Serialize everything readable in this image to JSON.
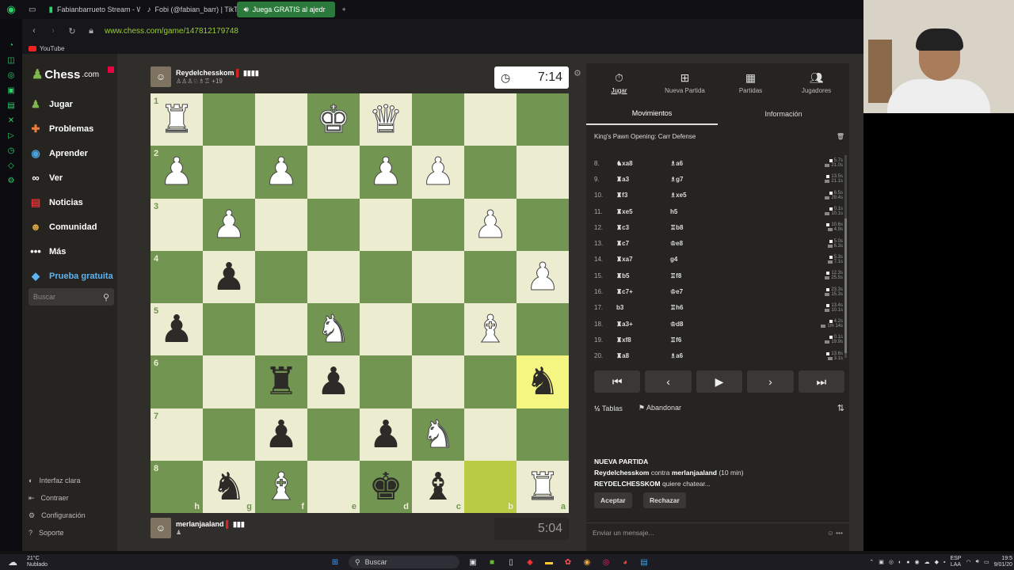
{
  "browser": {
    "tabs": [
      {
        "label": "Fabianbarrueto Stream - W",
        "icon": "twitch-icon",
        "active": false
      },
      {
        "label": "Fobi (@fabian_barr) | TikT",
        "icon": "tiktok-icon",
        "active": false
      },
      {
        "label": "Juega GRATIS al ajedr",
        "icon": "chess-icon",
        "active": true
      }
    ],
    "url": "www.chess.com/game/147812179748",
    "bookmark": "YouTube"
  },
  "sidebar": {
    "logo": "Chess",
    "logo_suffix": ".com",
    "items": [
      {
        "label": "Jugar",
        "icon": "pawn-icon"
      },
      {
        "label": "Problemas",
        "icon": "puzzle-icon"
      },
      {
        "label": "Aprender",
        "icon": "learn-icon"
      },
      {
        "label": "Ver",
        "icon": "binoculars-icon"
      },
      {
        "label": "Noticias",
        "icon": "news-icon"
      },
      {
        "label": "Comunidad",
        "icon": "community-icon"
      },
      {
        "label": "Más",
        "icon": "more-icon"
      },
      {
        "label": "Prueba gratuita",
        "icon": "diamond-icon"
      }
    ],
    "search_placeholder": "Buscar",
    "bottom": [
      {
        "label": "Interfaz clara",
        "icon": "theme-icon"
      },
      {
        "label": "Contraer",
        "icon": "collapse-icon"
      },
      {
        "label": "Configuración",
        "icon": "gear-icon"
      },
      {
        "label": "Soporte",
        "icon": "help-icon"
      }
    ]
  },
  "top_player": {
    "name": "Reydelchesskom",
    "material": "+19",
    "clock": "7:14"
  },
  "bottom_player": {
    "name": "merlanjaaland",
    "clock": "5:04"
  },
  "board": {
    "ranks": [
      "1",
      "2",
      "3",
      "4",
      "5",
      "6",
      "7",
      "8"
    ],
    "files": [
      "h",
      "g",
      "f",
      "e",
      "d",
      "c",
      "b",
      "a"
    ],
    "highlight": [
      [
        5,
        7
      ],
      [
        7,
        6
      ]
    ],
    "pieces": [
      [
        "wR",
        "",
        "",
        "wK",
        "wQ",
        "",
        "",
        ""
      ],
      [
        "wP",
        "",
        "wP",
        "",
        "wP",
        "wP",
        "",
        ""
      ],
      [
        "",
        "wP",
        "",
        "",
        "",
        "",
        "wP",
        ""
      ],
      [
        "",
        "bP",
        "",
        "",
        "",
        "",
        "",
        "wP"
      ],
      [
        "bP",
        "",
        "",
        "wN",
        "",
        "",
        "wB",
        ""
      ],
      [
        "",
        "",
        "bR",
        "bP",
        "",
        "",
        "",
        "bN"
      ],
      [
        "",
        "",
        "bP",
        "",
        "bP",
        "wN",
        "",
        ""
      ],
      [
        "",
        "bN",
        "wB",
        "",
        "bK",
        "bB",
        "",
        "wR"
      ]
    ]
  },
  "right_panel": {
    "tabs": [
      {
        "label": "Jugar",
        "icon": "timer-icon"
      },
      {
        "label": "Nueva Partida",
        "icon": "plus-icon"
      },
      {
        "label": "Partidas",
        "icon": "board-icon"
      },
      {
        "label": "Jugadores",
        "icon": "players-icon"
      }
    ],
    "subtabs": [
      "Movimientos",
      "Información"
    ],
    "opening": "King's Pawn Opening: Carr Defense",
    "moves": [
      {
        "n": "8.",
        "w": "♞xa8",
        "b": "♗a6",
        "tw": "5.7s",
        "tb": "21.0s"
      },
      {
        "n": "9.",
        "w": "♜a3",
        "b": "♗g7",
        "tw": "13.5s",
        "tb": "21.1s"
      },
      {
        "n": "10.",
        "w": "♜f3",
        "b": "♗xe5",
        "tw": "6.5s",
        "tb": "29.4s"
      },
      {
        "n": "11.",
        "w": "♜xe5",
        "b": "h5",
        "tw": "0.1s",
        "tb": "10.1s"
      },
      {
        "n": "12.",
        "w": "♜c3",
        "b": "♖b8",
        "tw": "10.6s",
        "tb": "4.9s"
      },
      {
        "n": "13.",
        "w": "♜c7",
        "b": "♔e8",
        "tw": "5.0s",
        "tb": "6.3s"
      },
      {
        "n": "14.",
        "w": "♜xa7",
        "b": "g4",
        "tw": "5.3s",
        "tb": "7.1s"
      },
      {
        "n": "15.",
        "w": "♜b5",
        "b": "♖f8",
        "tw": "12.3s",
        "tb": "25.5s"
      },
      {
        "n": "16.",
        "w": "♜c7+",
        "b": "♔e7",
        "tw": "23.3s",
        "tb": "15.3s"
      },
      {
        "n": "17.",
        "w": "b3",
        "b": "♖h6",
        "tw": "13.4s",
        "tb": "10.1s"
      },
      {
        "n": "18.",
        "w": "♜a3+",
        "b": "♔d8",
        "tw": "4.2s",
        "tb": "1m 14s"
      },
      {
        "n": "19.",
        "w": "♜xf8",
        "b": "♖f6",
        "tw": "0.1s",
        "tb": "19.9s"
      },
      {
        "n": "20.",
        "w": "♜a8",
        "b": "♗a6",
        "tw": "13.6s",
        "tb": "3.1s"
      }
    ],
    "draw": "Tablas",
    "draw_icon": "½",
    "resign": "Abandonar",
    "new_game_title": "NUEVA PARTIDA",
    "new_game_player": "Reydelchesskom",
    "new_game_vs": " contra ",
    "new_game_opponent": "merlanjaaland",
    "new_game_time": " (10 min)",
    "chat_user": "REYDELCHESSKOM",
    "chat_text": " quiere chatear...",
    "accept": "Aceptar",
    "reject": "Rechazar",
    "message_placeholder": "Enviar un mensaje..."
  },
  "taskbar": {
    "weather_temp": "21°C",
    "weather_desc": "Nublado",
    "search": "Buscar",
    "lang": "ESP",
    "lang_sub": "LAA",
    "time": "19:5",
    "date": "9/01/20"
  }
}
